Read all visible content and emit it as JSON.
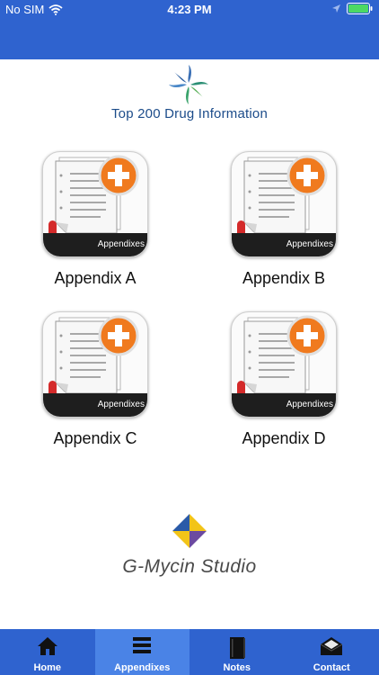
{
  "status": {
    "carrier": "No SIM",
    "time": "4:23 PM",
    "icons": [
      "wifi-icon",
      "location-arrow-icon",
      "battery-icon"
    ]
  },
  "header": {
    "title": "Top 200 Drug Information"
  },
  "appendix_tiles": [
    {
      "label": "Appendix A",
      "badge": "Appendixes"
    },
    {
      "label": "Appendix B",
      "badge": "Appendixes"
    },
    {
      "label": "Appendix C",
      "badge": "Appendixes"
    },
    {
      "label": "Appendix D",
      "badge": "Appendixes"
    }
  ],
  "footer_brand": {
    "name": "G-Mycin Studio"
  },
  "tab_bar": {
    "tabs": [
      {
        "label": "Home",
        "icon": "home-icon",
        "active": false
      },
      {
        "label": "Appendixes",
        "icon": "list-icon",
        "active": true
      },
      {
        "label": "Notes",
        "icon": "notebook-icon",
        "active": false
      },
      {
        "label": "Contact",
        "icon": "mail-icon",
        "active": false
      }
    ]
  },
  "colors": {
    "bar_blue": "#2f63cf",
    "active_tab": "#4a83e6",
    "plus_orange": "#f07a1e",
    "title_blue": "#1c4c8a"
  }
}
